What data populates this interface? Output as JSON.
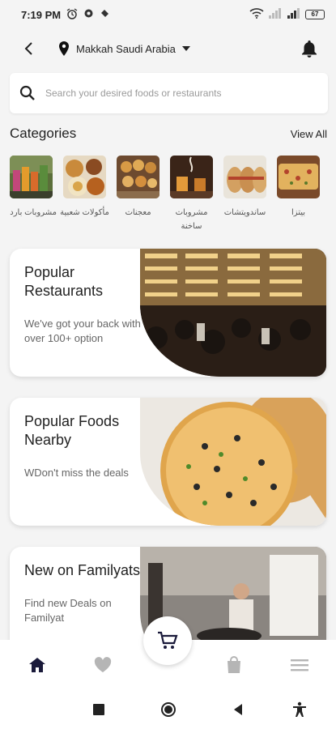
{
  "status_bar": {
    "time": "7:19 PM",
    "battery": "67"
  },
  "header": {
    "location": "Makkah Saudi Arabia"
  },
  "search": {
    "placeholder": "Search your desired foods or restaurants"
  },
  "categories": {
    "title": "Categories",
    "view_all": "View All",
    "items": [
      {
        "label": "مشروبات باردة",
        "icon": "cold-drinks-image"
      },
      {
        "label": "مأكولات شعبية",
        "icon": "popular-dishes-image"
      },
      {
        "label": "معجنات",
        "icon": "pastries-image"
      },
      {
        "label": "مشروبات ساخنة",
        "icon": "hot-drinks-image"
      },
      {
        "label": "ساندويتشات",
        "icon": "sandwiches-image"
      },
      {
        "label": "بيتزا",
        "icon": "pizza-image"
      }
    ]
  },
  "cards": [
    {
      "title": "Popular Restaurants",
      "subtitle": "We've got your back with over 100+ option",
      "image": "restaurant-interior-image"
    },
    {
      "title": "Popular Foods Nearby",
      "subtitle": "WDon't miss the deals",
      "image": "pizza-image"
    },
    {
      "title": "New on Familyats",
      "subtitle": "Find new Deals on Familyat",
      "image": "chef-cooking-image"
    }
  ],
  "bottom_nav": {
    "items": [
      "home-icon",
      "heart-icon",
      "cart-icon",
      "bag-icon",
      "menu-icon"
    ],
    "active_color": "#1a1a3a",
    "inactive_color": "#b5b5b5"
  }
}
